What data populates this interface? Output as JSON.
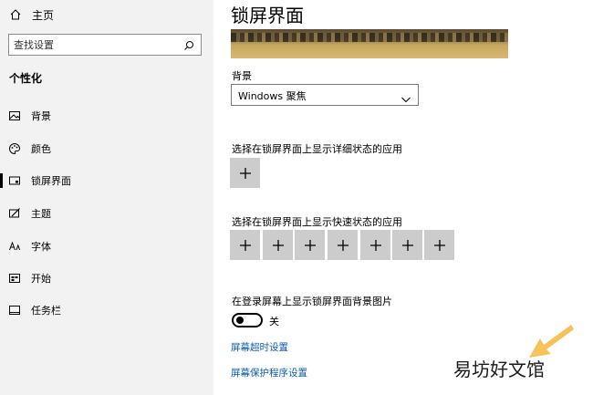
{
  "sidebar": {
    "home_label": "主页",
    "search_placeholder": "查找设置",
    "section_title": "个性化",
    "items": [
      {
        "label": "背景",
        "icon": "picture-icon"
      },
      {
        "label": "颜色",
        "icon": "palette-icon"
      },
      {
        "label": "锁屏界面",
        "icon": "lockscreen-icon",
        "active": true
      },
      {
        "label": "主题",
        "icon": "theme-icon"
      },
      {
        "label": "字体",
        "icon": "font-icon"
      },
      {
        "label": "开始",
        "icon": "start-icon"
      },
      {
        "label": "任务栏",
        "icon": "taskbar-icon"
      }
    ]
  },
  "main": {
    "title": "锁屏界面",
    "background_label": "背景",
    "background_value": "Windows 聚焦",
    "detail_status_label": "选择在锁屏界面上显示详细状态的应用",
    "quick_status_label": "选择在锁屏界面上显示快速状态的应用",
    "plus_symbol": "+",
    "login_bg_label": "在登录屏幕上显示锁屏界面背景图片",
    "toggle_state": "关",
    "toggle_on": false,
    "link_timeout": "屏幕超时设置",
    "link_screensaver": "屏幕保护程序设置"
  },
  "watermark": "易坊好文馆",
  "colors": {
    "link": "#0b5cad",
    "sidebar_bg": "#f2f2f2",
    "add_tile": "#cccccc",
    "arrow": "#f5c35a"
  }
}
